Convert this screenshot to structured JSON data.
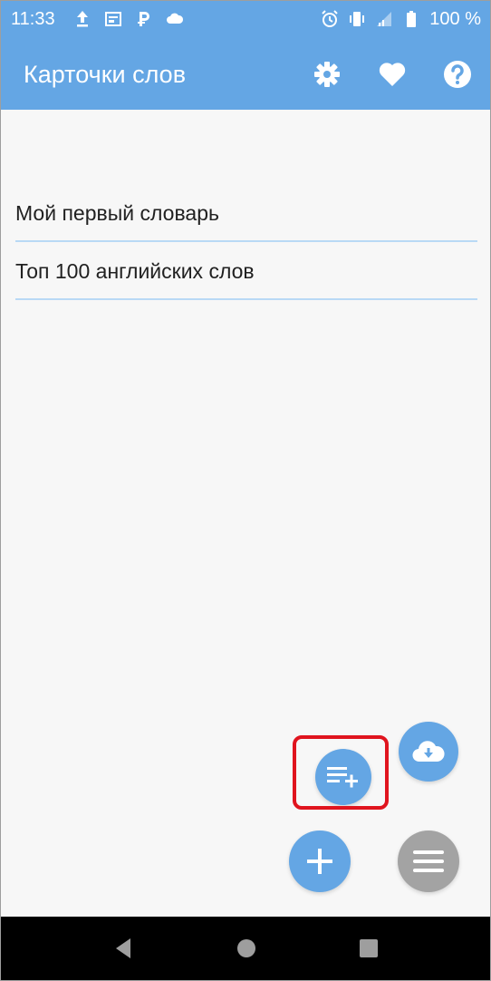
{
  "status_bar": {
    "time": "11:33",
    "battery_percent": "100 %",
    "left_icons": [
      "upload-icon",
      "cast-icon",
      "p-icon",
      "cloud-icon"
    ],
    "right_icons": [
      "alarm-icon",
      "vibrate-icon",
      "signal-icon",
      "battery-icon"
    ]
  },
  "app_bar": {
    "title": "Карточки слов",
    "actions": [
      "settings-icon",
      "heart-icon",
      "help-icon"
    ]
  },
  "dictionaries": [
    {
      "label": "Мой первый словарь"
    },
    {
      "label": "Топ 100 английских слов"
    }
  ],
  "fabs": [
    "add-list-icon",
    "cloud-download-icon",
    "plus-icon",
    "menu-icon"
  ],
  "colors": {
    "primary": "#64a6e4",
    "divider": "#b9d9f5",
    "fab_gray": "#a3a3a3",
    "highlight": "#e0141e",
    "nav_bar": "#000000"
  },
  "nav_bar": [
    "back-icon",
    "home-icon",
    "recents-icon"
  ]
}
